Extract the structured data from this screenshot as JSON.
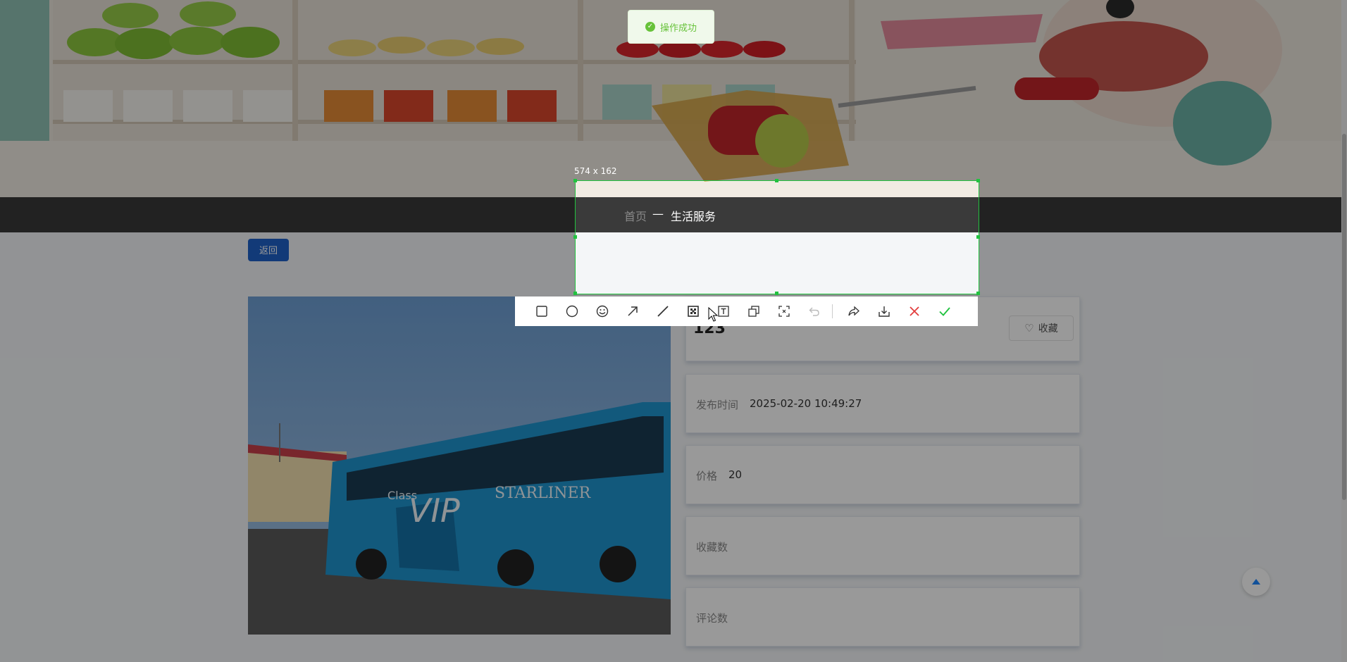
{
  "selection": {
    "size_label": "574 x 162"
  },
  "breadcrumb": {
    "home": "首页",
    "separator": "—",
    "current": "生活服务"
  },
  "back_button": {
    "label": "返回"
  },
  "detail": {
    "title": "123",
    "favorite_label": "收藏",
    "publish_time_label": "发布时间",
    "publish_time": "2025-02-20 10:49:27",
    "price_label": "价格",
    "price": "20",
    "favorites_label": "收藏数",
    "comments_label": "评论数"
  },
  "photo": {
    "bus_texts": [
      "Class",
      "VIP",
      "STARLINER"
    ]
  },
  "toast": {
    "message": "操作成功"
  },
  "toolbar": {
    "tools": [
      "rectangle-icon",
      "ellipse-icon",
      "emoji-icon",
      "arrow-icon",
      "line-icon",
      "mosaic-icon",
      "text-icon",
      "copy-icon",
      "ocr-icon",
      "undo-icon",
      "share-icon",
      "download-icon",
      "close-icon",
      "confirm-icon"
    ]
  },
  "colors": {
    "accent": "#1e62c8",
    "selection": "#21c23f",
    "success": "#67c23a",
    "cancel": "#e23c3c"
  }
}
